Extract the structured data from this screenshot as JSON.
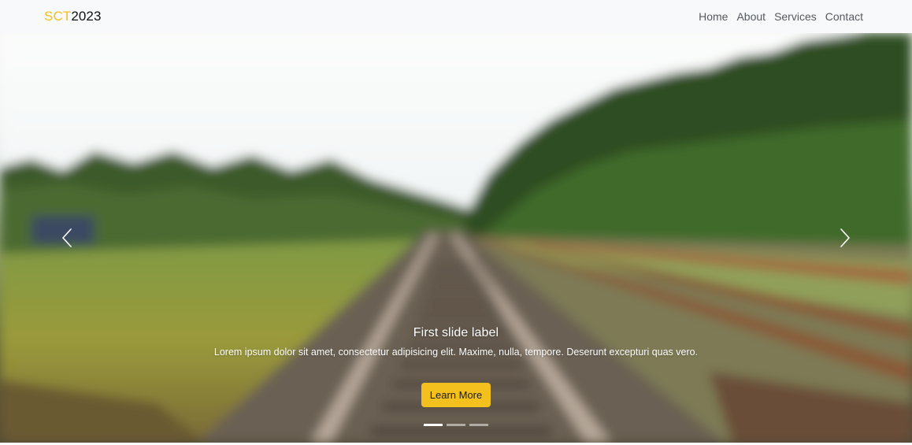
{
  "navbar": {
    "brand_accent": "SCT",
    "brand_rest": "2023",
    "links": [
      {
        "label": "Home"
      },
      {
        "label": "About"
      },
      {
        "label": "Services"
      },
      {
        "label": "Contact"
      }
    ]
  },
  "carousel": {
    "slide": {
      "title": "First slide label",
      "text": "Lorem ipsum dolor sit amet, consectetur adipisicing elit. Maxime, nulla, tempore. Deserunt excepturi quas vero.",
      "button_label": "Learn More",
      "background": "blurred railway tracks through green forest"
    },
    "indicators": [
      {
        "active": true
      },
      {
        "active": false
      },
      {
        "active": false
      }
    ],
    "prev_icon": "chevron-left-icon",
    "next_icon": "chevron-right-icon"
  },
  "colors": {
    "accent": "#f4c01e",
    "navbar_bg": "#f8f9fa",
    "nav_link": "#555a60"
  }
}
